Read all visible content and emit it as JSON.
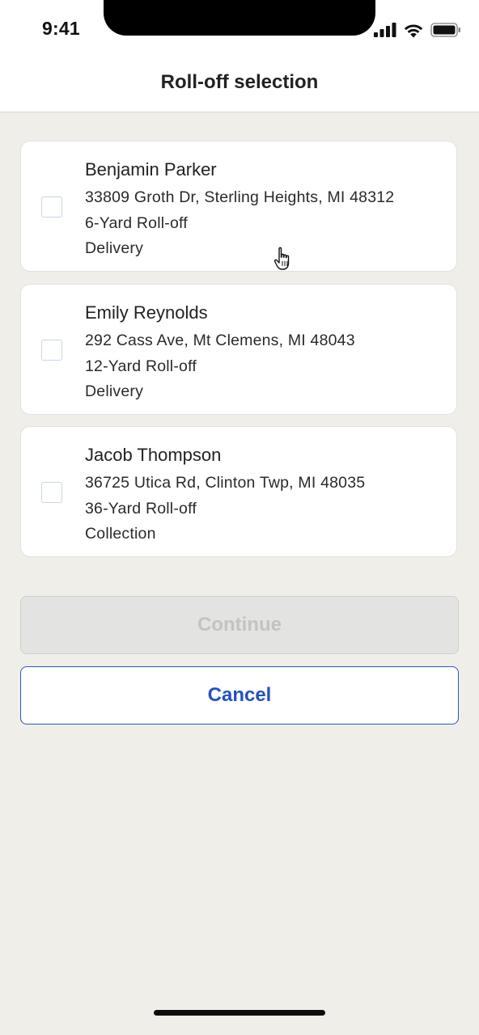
{
  "status_bar": {
    "time": "9:41",
    "icons": [
      "cellular-signal-icon",
      "wifi-icon",
      "battery-icon"
    ]
  },
  "header": {
    "title": "Roll-off selection"
  },
  "orders": [
    {
      "name": "Benjamin Parker",
      "address": "33809 Groth Dr, Sterling Heights, MI 48312",
      "container": "6-Yard Roll-off",
      "service": "Delivery",
      "checked": false
    },
    {
      "name": "Emily Reynolds",
      "address": "292 Cass Ave, Mt Clemens, MI 48043",
      "container": "12-Yard Roll-off",
      "service": "Delivery",
      "checked": false
    },
    {
      "name": "Jacob Thompson",
      "address": "36725 Utica Rd, Clinton Twp, MI 48035",
      "container": "36-Yard Roll-off",
      "service": "Collection",
      "checked": false
    }
  ],
  "actions": {
    "continue_label": "Continue",
    "continue_enabled": false,
    "cancel_label": "Cancel"
  },
  "colors": {
    "background": "#efeee9",
    "card": "#ffffff",
    "accent": "#2450c2",
    "disabled_text": "#c3c3c1"
  }
}
